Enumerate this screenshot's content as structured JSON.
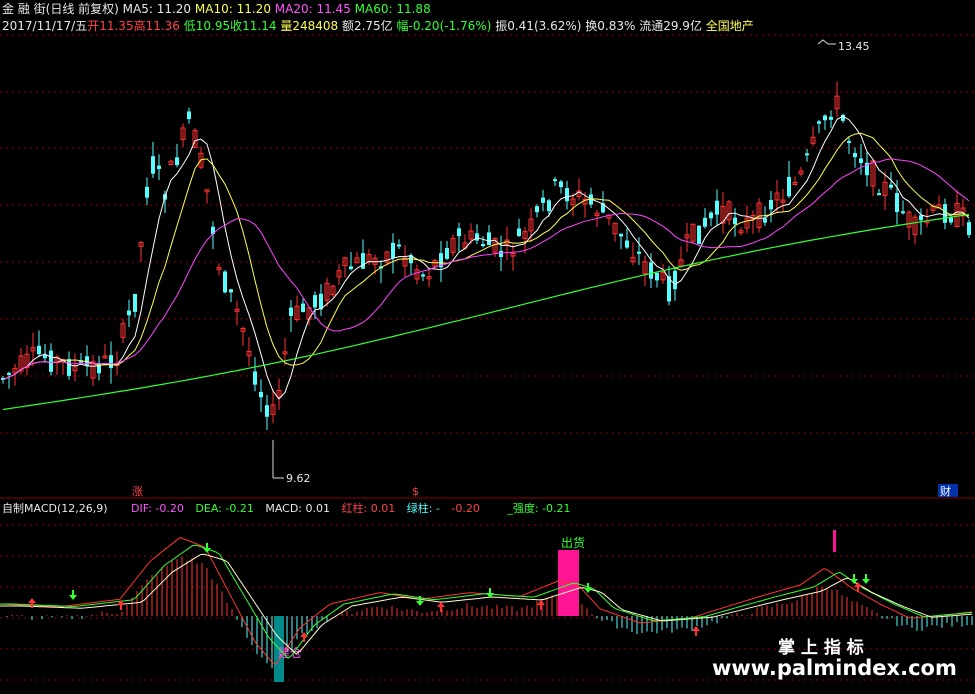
{
  "header1": {
    "stock_name": "金 融 街",
    "period": "(日线 前复权)",
    "ma5": "MA5: 11.20",
    "ma10": "MA10: 11.20",
    "ma20": "MA20: 11.45",
    "ma60": "MA60: 11.88"
  },
  "header2": {
    "date": "2017/11/17/五",
    "open": "开11.35",
    "high": "高11.36",
    "low": "低10.95",
    "close": "收11.14",
    "volume": "量248408",
    "amount": "额2.75亿",
    "change": "幅-0.20(-1.76%)",
    "amplitude": "振0.41(3.62%)",
    "turnover": "换0.83%",
    "float_cap": "流通29.9亿",
    "sector": "全国地产"
  },
  "price_panel": {
    "high_label": "13.45",
    "low_label": "9.62",
    "marker_zhang": "涨",
    "marker_mid": "$",
    "marker_cai": "财"
  },
  "macd_header": {
    "name": "自制MACD(12,26,9)",
    "dif": "DIF: -0.20",
    "dea": "DEA: -0.21",
    "macd": "MACD: 0.01",
    "red_bar": "红柱: 0.01",
    "green_bar": "绿柱: -",
    "dash": "-0.20",
    "strength": "_强度: -0.21"
  },
  "macd_panel": {
    "sell_label": "出货",
    "buy_label": "建仓"
  },
  "watermark": {
    "cn": "掌 上 指 标",
    "url": "www.palmindex.com"
  },
  "colors": {
    "up": "#ff3333",
    "down": "#55ffff",
    "ma5": "#ffffff",
    "ma10": "#ffff55",
    "ma20": "#ff44ff",
    "ma60": "#33ff33"
  }
}
